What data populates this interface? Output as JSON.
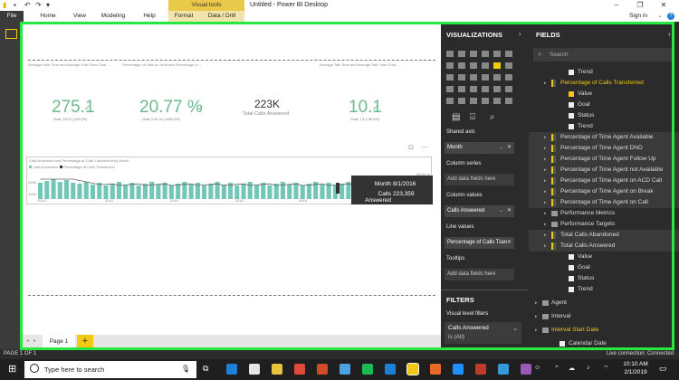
{
  "titlebar": {
    "visual_tools": "Visual tools",
    "title": "Untitled - Power BI Desktop",
    "minimize": "–",
    "maximize": "❐",
    "close": "✕"
  },
  "ribbon": {
    "tabs": [
      "File",
      "Home",
      "View",
      "Modeling",
      "Help",
      "Format",
      "Data / Drill"
    ],
    "sign_in": "Sign in"
  },
  "canvas": {
    "visual_titles": [
      "Average Hold Time and Average Hold Time Goal ...",
      "Percentage of Calls on Hold and Percentage of ...",
      "Average Talk Time and Average Talk Time Goal ..."
    ],
    "kpis": [
      {
        "value": "275.1",
        "mark": "✓",
        "goal": "Goal: 120.0 (-129.2%)"
      },
      {
        "value": "20.77 %",
        "mark": "✓",
        "goal": "Goal: 0.50 % (-4054.0%)"
      },
      {
        "value": "10.1",
        "mark": "✓",
        "goal": "Goal: 7.4 (+36.5%)"
      }
    ],
    "card": {
      "value": "223K",
      "label": "Total Calls Answered"
    },
    "chart": {
      "title": "Calls Answered and Percentage of Calls Transferred by Month",
      "legend": [
        "Calls Answered",
        "Percentage of Calls Transferred"
      ],
      "y_left": [
        "200K",
        "100K"
      ],
      "y_right": "35.00 %",
      "x_ticks": [
        "2012",
        "2013",
        "2014",
        "2015",
        "2016"
      ]
    },
    "tooltip": {
      "month_label": "Month",
      "month_value": "8/1/2016",
      "calls_label": "Calls Answered",
      "calls_value": "223,359"
    }
  },
  "pages": {
    "tab": "Page 1",
    "add": "+"
  },
  "visualizations": {
    "header": "VISUALIZATIONS",
    "sections": [
      {
        "label": "Shared axis",
        "value": "Month",
        "filled": true
      },
      {
        "label": "Column series",
        "value": "Add data fields here",
        "filled": false
      },
      {
        "label": "Column values",
        "value": "Calls Answered",
        "filled": true
      },
      {
        "label": "Line values",
        "value": "Percentage of Calls Tran",
        "filled": true
      },
      {
        "label": "Tooltips",
        "value": "Add data fields here",
        "filled": false
      }
    ],
    "filters_header": "FILTERS",
    "visual_filters_label": "Visual level filters",
    "filter_item_name": "Calls Answered",
    "filter_item_state": "is (All)"
  },
  "fields": {
    "header": "FIELDS",
    "search_placeholder": "Search",
    "rows": [
      {
        "text": "Trend",
        "kind": "check",
        "checked": false,
        "indent": 2,
        "hl": false,
        "color": ""
      },
      {
        "text": "Percentage of Calls Transferred",
        "kind": "measure",
        "indent": 1,
        "hl": false,
        "color": "#f2c811"
      },
      {
        "text": "Value",
        "kind": "check",
        "checked": true,
        "indent": 2,
        "hl": false,
        "color": ""
      },
      {
        "text": "Goal",
        "kind": "check",
        "checked": false,
        "indent": 2,
        "hl": false,
        "color": ""
      },
      {
        "text": "Status",
        "kind": "check",
        "checked": false,
        "indent": 2,
        "hl": false,
        "color": ""
      },
      {
        "text": "Trend",
        "kind": "check",
        "checked": false,
        "indent": 2,
        "hl": false,
        "color": ""
      },
      {
        "text": "Percentage of Time Agent Available",
        "kind": "measure",
        "indent": 1,
        "hl": true,
        "color": ""
      },
      {
        "text": "Percentage of Time Agent DND",
        "kind": "measure",
        "indent": 1,
        "hl": true,
        "color": ""
      },
      {
        "text": "Percentage of Time Agent Follow Up",
        "kind": "measure",
        "indent": 1,
        "hl": true,
        "color": ""
      },
      {
        "text": "Percentage of Time Agent not Available",
        "kind": "measure",
        "indent": 1,
        "hl": true,
        "color": ""
      },
      {
        "text": "Percentage of Time Agent on ACD Call",
        "kind": "measure",
        "indent": 1,
        "hl": true,
        "color": ""
      },
      {
        "text": "Percentage of Time Agent on Break",
        "kind": "measure",
        "indent": 1,
        "hl": true,
        "color": ""
      },
      {
        "text": "Percentage of Time Agent on Call",
        "kind": "measure",
        "indent": 1,
        "hl": true,
        "color": ""
      },
      {
        "text": "Performance Metrics",
        "kind": "table",
        "indent": 1,
        "hl": false,
        "color": ""
      },
      {
        "text": "Performance Targets",
        "kind": "table",
        "indent": 1,
        "hl": false,
        "color": ""
      },
      {
        "text": "Total Calls Abandoned",
        "kind": "measure",
        "indent": 1,
        "hl": true,
        "color": ""
      },
      {
        "text": "Total Calls Answered",
        "kind": "measure",
        "indent": 1,
        "hl": true,
        "color": ""
      },
      {
        "text": "Value",
        "kind": "check",
        "checked": false,
        "indent": 2,
        "hl": false,
        "color": ""
      },
      {
        "text": "Goal",
        "kind": "check",
        "checked": false,
        "indent": 2,
        "hl": false,
        "color": ""
      },
      {
        "text": "Status",
        "kind": "check",
        "checked": false,
        "indent": 2,
        "hl": false,
        "color": ""
      },
      {
        "text": "Trend",
        "kind": "check",
        "checked": false,
        "indent": 2,
        "hl": false,
        "color": ""
      },
      {
        "text": "",
        "kind": "spacer",
        "indent": 0,
        "hl": false,
        "color": ""
      },
      {
        "text": "Agent",
        "kind": "table",
        "indent": 0,
        "hl": false,
        "color": ""
      },
      {
        "text": "",
        "kind": "spacer",
        "indent": 0,
        "hl": false,
        "color": ""
      },
      {
        "text": "Interval",
        "kind": "table",
        "indent": 0,
        "hl": false,
        "color": ""
      },
      {
        "text": "",
        "kind": "spacer",
        "indent": 0,
        "hl": false,
        "color": ""
      },
      {
        "text": "Interval Start Date",
        "kind": "table",
        "indent": 0,
        "hl": false,
        "color": "#f2c811"
      },
      {
        "text": "",
        "kind": "spacer",
        "indent": 0,
        "hl": false,
        "color": ""
      },
      {
        "text": "Calendar Date",
        "kind": "check",
        "checked": false,
        "indent": 1,
        "hl": false,
        "color": ""
      }
    ]
  },
  "status": {
    "left": "PAGE 1 OF 1",
    "right": "Live connection: Connected"
  },
  "taskbar": {
    "search_placeholder": "Type here to search",
    "time": "10:10 AM",
    "date": "2/1/2019",
    "icons": [
      "edge-icon",
      "mail-icon",
      "explorer-icon",
      "chrome-icon",
      "app-icon",
      "app2-icon",
      "spotify-icon",
      "bluetooth-icon",
      "powerbi-icon",
      "app3-icon",
      "app4-icon",
      "app5-icon",
      "app6-icon",
      "app7-icon"
    ],
    "icon_colors": [
      "#1e7fd6",
      "#e6e6e6",
      "#e8c23a",
      "#de4a3a",
      "#d04a2a",
      "#4aa3e0",
      "#1db954",
      "#1e7fd6",
      "#f2c811",
      "#e66a2a",
      "#1e90ff",
      "#c0392b",
      "#3498db",
      "#9b59b6"
    ]
  },
  "colors": {
    "accent": "#f2c811",
    "kpi": "#6fb98f",
    "bars": "#74c7b8",
    "frame": "#27e83f"
  }
}
